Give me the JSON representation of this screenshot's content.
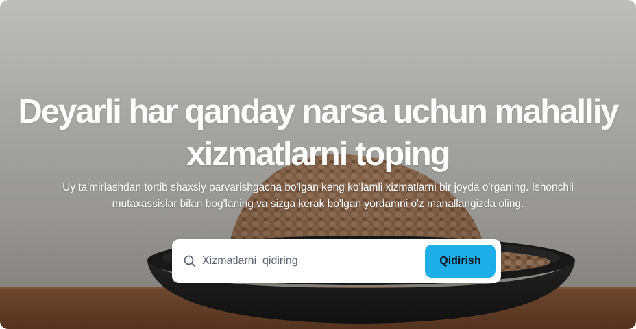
{
  "hero": {
    "headline": "Deyarli har qanday narsa uchun mahalliy xizmatlarni toping",
    "subtitle": "Uy ta'mirlashdan tortib shaxsiy parvarishgacha bo'lgan keng ko'lamli xizmatlarni bir joyda o'rganing. Ishonchli mutaxassislar bilan bog'laning va sizga kerak bo'lgan yordamni o'z mahallangizda oling."
  },
  "search": {
    "placeholder": "Xizmatlarni  qidiring",
    "value": "",
    "button_label": "Qidirish",
    "icon": "search-icon"
  },
  "colors": {
    "accent": "#1daee8",
    "headline_text": "#ffffff",
    "search_background": "#ffffff"
  }
}
